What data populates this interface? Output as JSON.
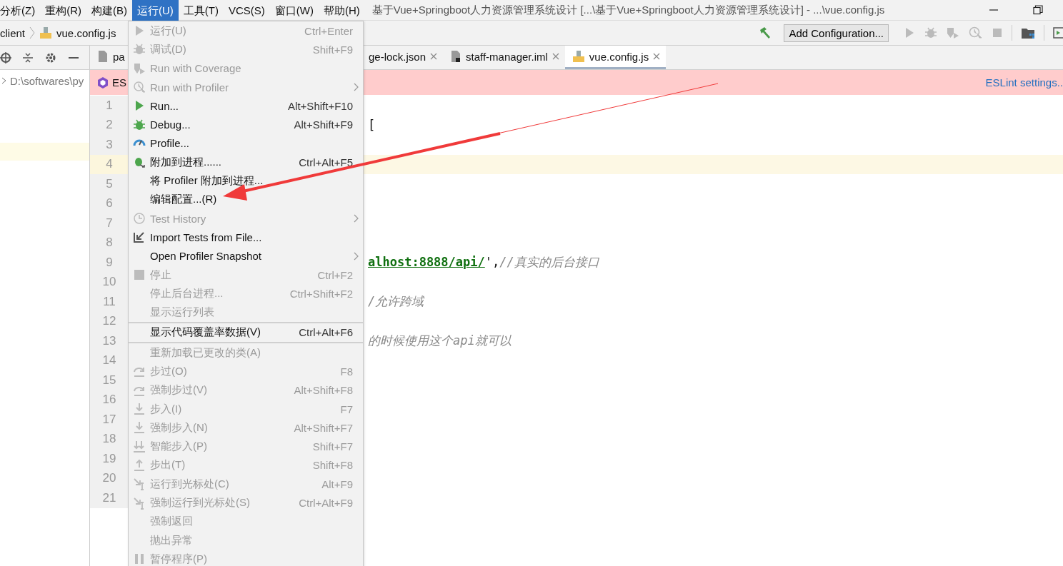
{
  "menubar": {
    "items": [
      {
        "label": "分析(Z)",
        "selected": false
      },
      {
        "label": "重构(R)",
        "selected": false
      },
      {
        "label": "构建(B)",
        "selected": false
      },
      {
        "label": "运行(U)",
        "selected": true
      },
      {
        "label": "工具(T)",
        "selected": false
      },
      {
        "label": "VCS(S)",
        "selected": false
      },
      {
        "label": "窗口(W)",
        "selected": false
      },
      {
        "label": "帮助(H)",
        "selected": false
      }
    ],
    "title": "基于Vue+Springboot人力资源管理系统设计 [...\\基于Vue+Springboot人力资源管理系统设计] - ...\\vue.config.js"
  },
  "toolbar": {
    "breadcrumb": [
      "client",
      "vue.config.js"
    ],
    "run_config_button": "Add Configuration..."
  },
  "project_panel": {
    "path": "D:\\softwares\\py"
  },
  "tabs": [
    {
      "label": "pa",
      "selected": false
    },
    {
      "label": "ge-lock.json",
      "selected": false
    },
    {
      "label": "staff-manager.iml",
      "selected": false
    },
    {
      "label": "vue.config.js",
      "selected": true
    }
  ],
  "banner": {
    "label": "ES",
    "link": "ESLint settings.."
  },
  "code_lines": [
    {
      "number": "1",
      "current": false
    },
    {
      "number": "2",
      "current": false,
      "tokens": [
        {
          "kind": "punct",
          "text": "["
        }
      ]
    },
    {
      "number": "3",
      "current": false
    },
    {
      "number": "4",
      "current": true
    },
    {
      "number": "5",
      "current": false
    },
    {
      "number": "6",
      "current": false
    },
    {
      "number": "7",
      "current": false
    },
    {
      "number": "8",
      "current": false
    },
    {
      "number": "9",
      "current": false,
      "tokens": [
        {
          "kind": "string",
          "text": "alhost:8888/api/"
        },
        {
          "kind": "punct",
          "text": "',"
        },
        {
          "kind": "comment",
          "text": "//真实的后台接口"
        }
      ]
    },
    {
      "number": "10",
      "current": false
    },
    {
      "number": "11",
      "current": false,
      "tokens": [
        {
          "kind": "comment",
          "text": "/允许跨域"
        }
      ]
    },
    {
      "number": "12",
      "current": false
    },
    {
      "number": "13",
      "current": false,
      "tokens": [
        {
          "kind": "comment",
          "text": "的时候使用这个api就可以"
        }
      ]
    },
    {
      "number": "14",
      "current": false
    },
    {
      "number": "15",
      "current": false
    },
    {
      "number": "16",
      "current": false
    },
    {
      "number": "17",
      "current": false
    },
    {
      "number": "18",
      "current": false
    },
    {
      "number": "19",
      "current": false
    },
    {
      "number": "20",
      "current": false
    },
    {
      "number": "21",
      "current": false
    }
  ],
  "run_menu": [
    {
      "kind": "item",
      "label": "运行(U)",
      "shortcut": "Ctrl+Enter",
      "disabled": true,
      "submenu": false
    },
    {
      "kind": "item",
      "label": "调试(D)",
      "shortcut": "Shift+F9",
      "disabled": true,
      "submenu": false
    },
    {
      "kind": "item",
      "label": "Run with Coverage",
      "disabled": true,
      "submenu": false
    },
    {
      "kind": "item",
      "label": "Run with Profiler",
      "disabled": true,
      "submenu": true
    },
    {
      "kind": "item",
      "label": "Run...",
      "shortcut": "Alt+Shift+F10",
      "disabled": false,
      "submenu": false
    },
    {
      "kind": "item",
      "label": "Debug...",
      "shortcut": "Alt+Shift+F9",
      "disabled": false,
      "submenu": false
    },
    {
      "kind": "item",
      "label": "Profile...",
      "disabled": false,
      "submenu": false
    },
    {
      "kind": "item",
      "label": "附加到进程......",
      "shortcut": "Ctrl+Alt+F5",
      "disabled": false,
      "submenu": false
    },
    {
      "kind": "item",
      "label": "将 Profiler 附加到进程...",
      "disabled": false,
      "submenu": false
    },
    {
      "kind": "item",
      "label": "编辑配置...(R)",
      "disabled": false,
      "submenu": false
    },
    {
      "kind": "item",
      "label": "Test History",
      "disabled": true,
      "submenu": true
    },
    {
      "kind": "item",
      "label": "Import Tests from File...",
      "disabled": false,
      "submenu": false
    },
    {
      "kind": "item",
      "label": "Open Profiler Snapshot",
      "disabled": false,
      "submenu": true
    },
    {
      "kind": "item",
      "label": "停止",
      "shortcut": "Ctrl+F2",
      "disabled": true,
      "submenu": false
    },
    {
      "kind": "item",
      "label": "停止后台进程...",
      "shortcut": "Ctrl+Shift+F2",
      "disabled": true,
      "submenu": false
    },
    {
      "kind": "item",
      "label": "显示运行列表",
      "disabled": true,
      "submenu": false
    },
    {
      "kind": "separator"
    },
    {
      "kind": "item",
      "label": "显示代码覆盖率数据(V)",
      "shortcut": "Ctrl+Alt+F6",
      "disabled": false,
      "submenu": false
    },
    {
      "kind": "separator"
    },
    {
      "kind": "item",
      "label": "重新加载已更改的类(A)",
      "disabled": true,
      "submenu": false
    },
    {
      "kind": "item",
      "label": "步过(O)",
      "shortcut": "F8",
      "disabled": true,
      "submenu": false
    },
    {
      "kind": "item",
      "label": "强制步过(V)",
      "shortcut": "Alt+Shift+F8",
      "disabled": true,
      "submenu": false
    },
    {
      "kind": "item",
      "label": "步入(I)",
      "shortcut": "F7",
      "disabled": true,
      "submenu": false
    },
    {
      "kind": "item",
      "label": "强制步入(N)",
      "shortcut": "Alt+Shift+F7",
      "disabled": true,
      "submenu": false
    },
    {
      "kind": "item",
      "label": "智能步入(P)",
      "shortcut": "Shift+F7",
      "disabled": true,
      "submenu": false
    },
    {
      "kind": "item",
      "label": "步出(T)",
      "shortcut": "Shift+F8",
      "disabled": true,
      "submenu": false
    },
    {
      "kind": "item",
      "label": "运行到光标处(C)",
      "shortcut": "Alt+F9",
      "disabled": true,
      "submenu": false
    },
    {
      "kind": "item",
      "label": "强制运行到光标处(S)",
      "shortcut": "Ctrl+Alt+F9",
      "disabled": true,
      "submenu": false
    },
    {
      "kind": "item",
      "label": "强制返回",
      "disabled": true,
      "submenu": false
    },
    {
      "kind": "item",
      "label": "抛出异常",
      "disabled": true,
      "submenu": false
    },
    {
      "kind": "item",
      "label": "暂停程序(P)",
      "disabled": true,
      "submenu": false
    }
  ]
}
